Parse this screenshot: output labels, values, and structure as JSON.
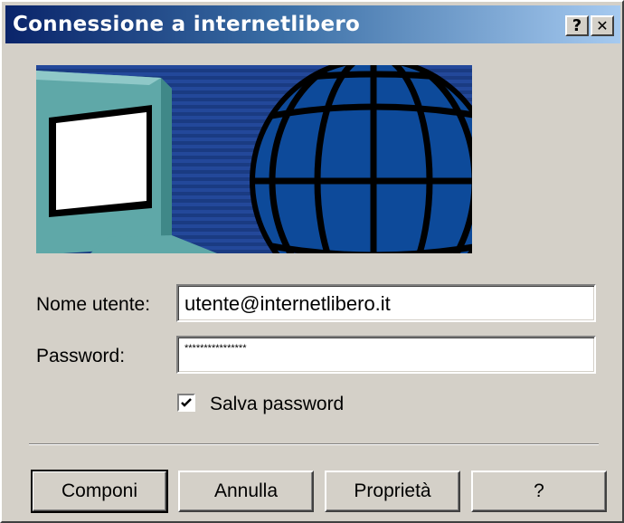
{
  "window": {
    "title": "Connessione a internetlibero",
    "help_button": "?",
    "close_button": "✕"
  },
  "form": {
    "username_label": "Nome utente:",
    "username_value": "utente@internetlibero.it",
    "password_label": "Password:",
    "password_value": "****************",
    "save_password_label": "Salva password",
    "save_password_checked": true
  },
  "buttons": {
    "dial": "Componi",
    "cancel": "Annulla",
    "properties": "Proprietà",
    "help": "?"
  },
  "colors": {
    "title_start": "#0a246a",
    "title_end": "#a6caf0",
    "dialog_bg": "#d4d0c8",
    "banner_blue": "#1a3b82",
    "globe_blue": "#0d4a9a",
    "monitor_teal": "#5fa8a8"
  },
  "icons": {
    "banner": "network-connection-illustration",
    "checkbox_mark": "checkmark-icon"
  }
}
